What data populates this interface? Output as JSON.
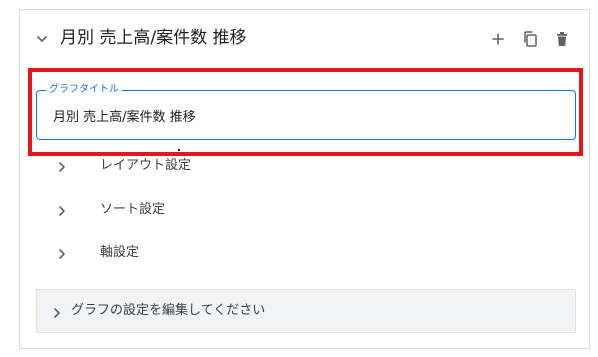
{
  "panel": {
    "title": "月別 売上高/案件数 推移",
    "actions": {
      "add_icon": "plus-icon",
      "copy_icon": "copy-icon",
      "delete_icon": "trash-icon"
    }
  },
  "graph_title_field": {
    "label": "グラフタイトル",
    "value": "月別 売上高/案件数 推移"
  },
  "sections": [
    {
      "label": "レイアウト設定",
      "icon": "chevron-right-icon"
    },
    {
      "label": "ソート設定",
      "icon": "chevron-right-icon"
    },
    {
      "label": "軸設定",
      "icon": "chevron-right-icon"
    }
  ],
  "edit_bar": {
    "label": "グラフの設定を編集してください",
    "icon": "chevron-right-icon"
  },
  "colors": {
    "accent_blue": "#1a73e8",
    "highlight_red": "#e8141e",
    "border_gray": "#dadce0",
    "bar_bg": "#f1f3f4",
    "text_dark": "#202124",
    "icon_gray": "#5f6368"
  }
}
